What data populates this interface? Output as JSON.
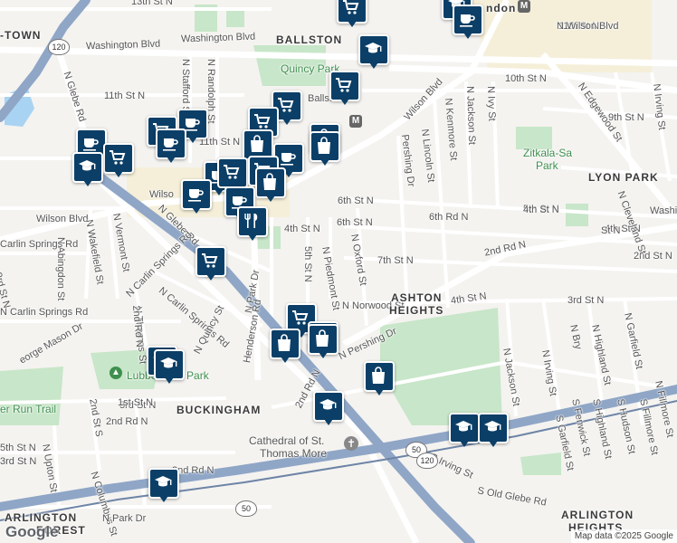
{
  "map": {
    "attribution": "Map data ©2025 Google",
    "logo": "Google",
    "area_labels": [
      {
        "text": "BALLSTON",
        "name": "area-label-ballston"
      },
      {
        "text": "LYON PARK",
        "name": "area-label-lyon-park"
      },
      {
        "text": "ASHTON",
        "name": "area-label-ashton-line1"
      },
      {
        "text": "HEIGHTS",
        "name": "area-label-ashton-line2"
      },
      {
        "text": "BUCKINGHAM",
        "name": "area-label-buckingham"
      },
      {
        "text": "ARLINGTON",
        "name": "area-label-arlington-heights-line1"
      },
      {
        "text": "HEIGHTS",
        "name": "area-label-arlington-heights-line2"
      },
      {
        "text": "ARLINGTON",
        "name": "area-label-arlington-forest-line1"
      },
      {
        "text": "FOREST",
        "name": "area-label-arlington-forest-line2"
      },
      {
        "text": "-TOWN",
        "name": "area-label-town-fragment"
      },
      {
        "text": "ndon",
        "name": "area-label-clarendon-fragment"
      }
    ],
    "park_labels": [
      {
        "text": "Quincy Park",
        "name": "park-label-quincy"
      },
      {
        "text": "Zitkala-Sa",
        "name": "park-label-zitkala-line1"
      },
      {
        "text": "Park",
        "name": "park-label-zitkala-line2"
      },
      {
        "text": "Lubber Run Park",
        "name": "park-label-lubber-run"
      },
      {
        "text": "er Run Trail",
        "name": "park-label-lubber-run-trail"
      }
    ],
    "poi_labels": [
      {
        "text": "Cathedral of St.",
        "name": "poi-cathedral-line1"
      },
      {
        "text": "Thomas More",
        "name": "poi-cathedral-line2"
      }
    ],
    "street_labels": [
      {
        "text": "13th St N",
        "name": "street-13th-st"
      },
      {
        "text": "Washington Blvd",
        "name": "street-washington-blvd-west"
      },
      {
        "text": "11th St N",
        "name": "street-11th-st-west"
      },
      {
        "text": "11th St N",
        "name": "street-11th-st-east"
      },
      {
        "text": "10th St N",
        "name": "street-10th-st"
      },
      {
        "text": "9th St N",
        "name": "street-9th-st"
      },
      {
        "text": "Washington Blvd",
        "name": "street-washington-blvd-east"
      },
      {
        "text": "N Stafford St",
        "name": "street-n-stafford"
      },
      {
        "text": "N Randolph St",
        "name": "street-n-randolph"
      },
      {
        "text": "N Glebe Rd",
        "name": "street-n-glebe-north"
      },
      {
        "text": "N Glebe Rd",
        "name": "street-n-glebe-south"
      },
      {
        "text": "Wilson Blvd",
        "name": "street-wilson-blvd-west"
      },
      {
        "text": "Wilson Blvd",
        "name": "street-wilson-blvd-east"
      },
      {
        "text": "Wilso",
        "name": "street-wilson-fragment"
      },
      {
        "text": "N Abingdon St",
        "name": "street-n-abingdon"
      },
      {
        "text": "N Wakefield St",
        "name": "street-n-wakefield"
      },
      {
        "text": "N Vermont St",
        "name": "street-n-vermont"
      },
      {
        "text": "N Carlin Springs Rd",
        "name": "street-n-carlin-springs"
      },
      {
        "text": "N Carlin Springs Rd",
        "name": "street-n-carlin-springs-south"
      },
      {
        "text": "N Thomas St",
        "name": "street-n-thomas"
      },
      {
        "text": "N Park Dr",
        "name": "street-n-park-dr"
      },
      {
        "text": "N Quincy St",
        "name": "street-n-quincy"
      },
      {
        "text": "Henderson Rd",
        "name": "street-henderson-rd"
      },
      {
        "text": "4th St N",
        "name": "street-4th-st-vertical"
      },
      {
        "text": "6th St N",
        "name": "street-6th-st-west"
      },
      {
        "text": "6th Rd N",
        "name": "street-6th-rd"
      },
      {
        "text": "6th St N",
        "name": "street-6th-st-east"
      },
      {
        "text": "7th St N",
        "name": "street-7th-st"
      },
      {
        "text": "5th St N",
        "name": "street-5th-st-mid"
      },
      {
        "text": "5th St N",
        "name": "street-5th-st-east"
      },
      {
        "text": "N Piedmont St",
        "name": "street-n-piedmont"
      },
      {
        "text": "N Oxford St",
        "name": "street-n-oxford"
      },
      {
        "text": "N Norwood St",
        "name": "street-n-norwood"
      },
      {
        "text": "4th St N",
        "name": "street-4th-st"
      },
      {
        "text": "4th St N",
        "name": "street-4th-st-east"
      },
      {
        "text": "3rd St N",
        "name": "street-3rd-st-east"
      },
      {
        "text": "3rd St N",
        "name": "street-3rd-st-west"
      },
      {
        "text": "2nd St N",
        "name": "street-2nd-st-east"
      },
      {
        "text": "2nd Rd N",
        "name": "street-2nd-rd-east"
      },
      {
        "text": "2nd Rd N",
        "name": "street-2nd-rd-mid"
      },
      {
        "text": "2nd Rd N",
        "name": "street-2nd-rd-west"
      },
      {
        "text": "N Pershing Dr",
        "name": "street-n-pershing"
      },
      {
        "text": "Pershing Dr",
        "name": "street-pershing-fragment"
      },
      {
        "text": "N Lincoln St",
        "name": "street-n-lincoln"
      },
      {
        "text": "N Kenmore St",
        "name": "street-n-kenmore"
      },
      {
        "text": "N Jackson St",
        "name": "street-n-jackson-north"
      },
      {
        "text": "N Jackson St",
        "name": "street-n-jackson-south"
      },
      {
        "text": "N Ivy St",
        "name": "street-n-ivy"
      },
      {
        "text": "N Irving St",
        "name": "street-n-irving-north"
      },
      {
        "text": "N Irving St",
        "name": "street-n-irving-south"
      },
      {
        "text": "N Cleveland St",
        "name": "street-n-cleveland"
      },
      {
        "text": "N Edgewood St",
        "name": "street-n-edgewood"
      },
      {
        "text": "Washington Blvd",
        "name": "street-washington-blvd-se"
      },
      {
        "text": "N Bry",
        "name": "street-n-bryan-fragment"
      },
      {
        "text": "N Highland St",
        "name": "street-n-highland"
      },
      {
        "text": "N Garfield St",
        "name": "street-n-garfield"
      },
      {
        "text": "N Fillmore St",
        "name": "street-n-fillmore"
      },
      {
        "text": "S Fillmore St",
        "name": "street-s-fillmore"
      },
      {
        "text": "S Fenwick St",
        "name": "street-s-fenwick"
      },
      {
        "text": "S Highland St",
        "name": "street-s-highland"
      },
      {
        "text": "S Hudson St",
        "name": "street-s-hudson"
      },
      {
        "text": "S Garfield St",
        "name": "street-s-garfield"
      },
      {
        "text": "S Irving St",
        "name": "street-s-irving"
      },
      {
        "text": "S Old Glebe Rd",
        "name": "street-s-old-glebe"
      },
      {
        "text": "2nd St S",
        "name": "street-2nd-st-s"
      },
      {
        "text": "N Upton St",
        "name": "street-n-upton"
      },
      {
        "text": "N Columbus St",
        "name": "street-n-columbus"
      },
      {
        "text": "N Park Dr",
        "name": "street-n-park-dr-south"
      },
      {
        "text": "1st St N",
        "name": "street-1st-st"
      },
      {
        "text": "3rd St N",
        "name": "street-3rd-st-sw"
      },
      {
        "text": "2nd Rd N",
        "name": "street-2nd-rd-sw"
      },
      {
        "text": "3rd St N",
        "name": "street-3rd-st-south"
      },
      {
        "text": "eorge Mason Dr",
        "name": "street-george-mason-fragment"
      },
      {
        "text": "Carlin Springs Rd",
        "name": "street-carlin-springs-sw"
      },
      {
        "text": "N Carlin Springs Rd",
        "name": "street-carlin-springs-west"
      },
      {
        "text": "N Wilson Blvd",
        "name": "street-n-wilson-blvd-west"
      },
      {
        "text": "11th St N",
        "name": "street-11th-st-ne"
      },
      {
        "text": "Ballston-",
        "name": "street-ballston-fragment"
      },
      {
        "text": "St N",
        "name": "street-st-n-fragment"
      },
      {
        "text": "4th St N",
        "name": "street-4th-st-se"
      },
      {
        "text": "5th St N",
        "name": "street-5th-st-far-east"
      },
      {
        "text": "3rd St N",
        "name": "street-3rd-st-sw2"
      },
      {
        "text": "2nd Rd N",
        "name": "street-2nd-rd-sw2"
      },
      {
        "text": "N Pa",
        "name": "street-n-park-fragment"
      }
    ],
    "highway_shields": [
      {
        "text": "120",
        "name": "route-120-shield-nw"
      },
      {
        "text": "50",
        "name": "route-50-shield-center"
      },
      {
        "text": "120",
        "name": "route-120-shield-south"
      },
      {
        "text": "50",
        "name": "route-50-shield-west"
      }
    ],
    "metro_labels": [
      {
        "text": "M",
        "name": "metro-station-icon-ballston"
      },
      {
        "text": "M",
        "name": "metro-station-icon-clarendon"
      }
    ],
    "markers": [
      {
        "kind": "shopping-cart",
        "name": "grocery-marker"
      },
      {
        "kind": "coffee-cup",
        "name": "cafe-marker"
      },
      {
        "kind": "graduation-cap",
        "name": "school-marker"
      },
      {
        "kind": "shopping-bag",
        "name": "shop-marker"
      },
      {
        "kind": "fork-knife",
        "name": "restaurant-marker"
      }
    ],
    "colors": {
      "background": "#f4f3f0",
      "park": "#c8e6c9",
      "highway": "#8fa6c6",
      "major_road": "#ffffff",
      "water": "#a9d3f2",
      "marker": "#0b3f67",
      "commercial": "#f5efd9"
    }
  }
}
